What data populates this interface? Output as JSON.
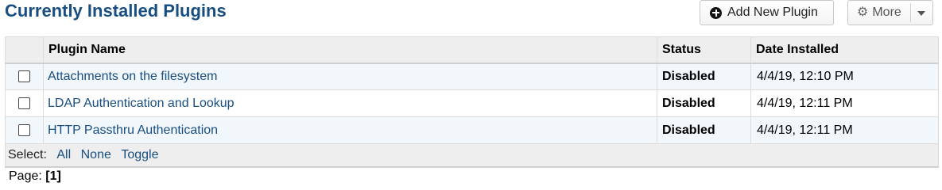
{
  "header": {
    "title": "Currently Installed Plugins",
    "add_button_label": "Add New Plugin",
    "more_button_label": "More"
  },
  "table": {
    "columns": [
      "Plugin Name",
      "Status",
      "Date Installed"
    ],
    "rows": [
      {
        "name": "Attachments on the filesystem",
        "status": "Disabled",
        "date": "4/4/19, 12:10 PM"
      },
      {
        "name": "LDAP Authentication and Lookup",
        "status": "Disabled",
        "date": "4/4/19, 12:11 PM"
      },
      {
        "name": "HTTP Passthru Authentication",
        "status": "Disabled",
        "date": "4/4/19, 12:11 PM"
      }
    ]
  },
  "footer": {
    "select_label": "Select:",
    "all": "All",
    "none": "None",
    "toggle": "Toggle"
  },
  "pager": {
    "label": "Page:",
    "current": "[1]"
  },
  "icons": {
    "add": "plus-circle-icon",
    "more": "gear-icon",
    "caret": "chevron-down-icon"
  },
  "colors": {
    "title": "#184E81",
    "link": "#184E81",
    "header_bg": "#eeeeee",
    "row_alt_bg": "#f1f7fb"
  }
}
